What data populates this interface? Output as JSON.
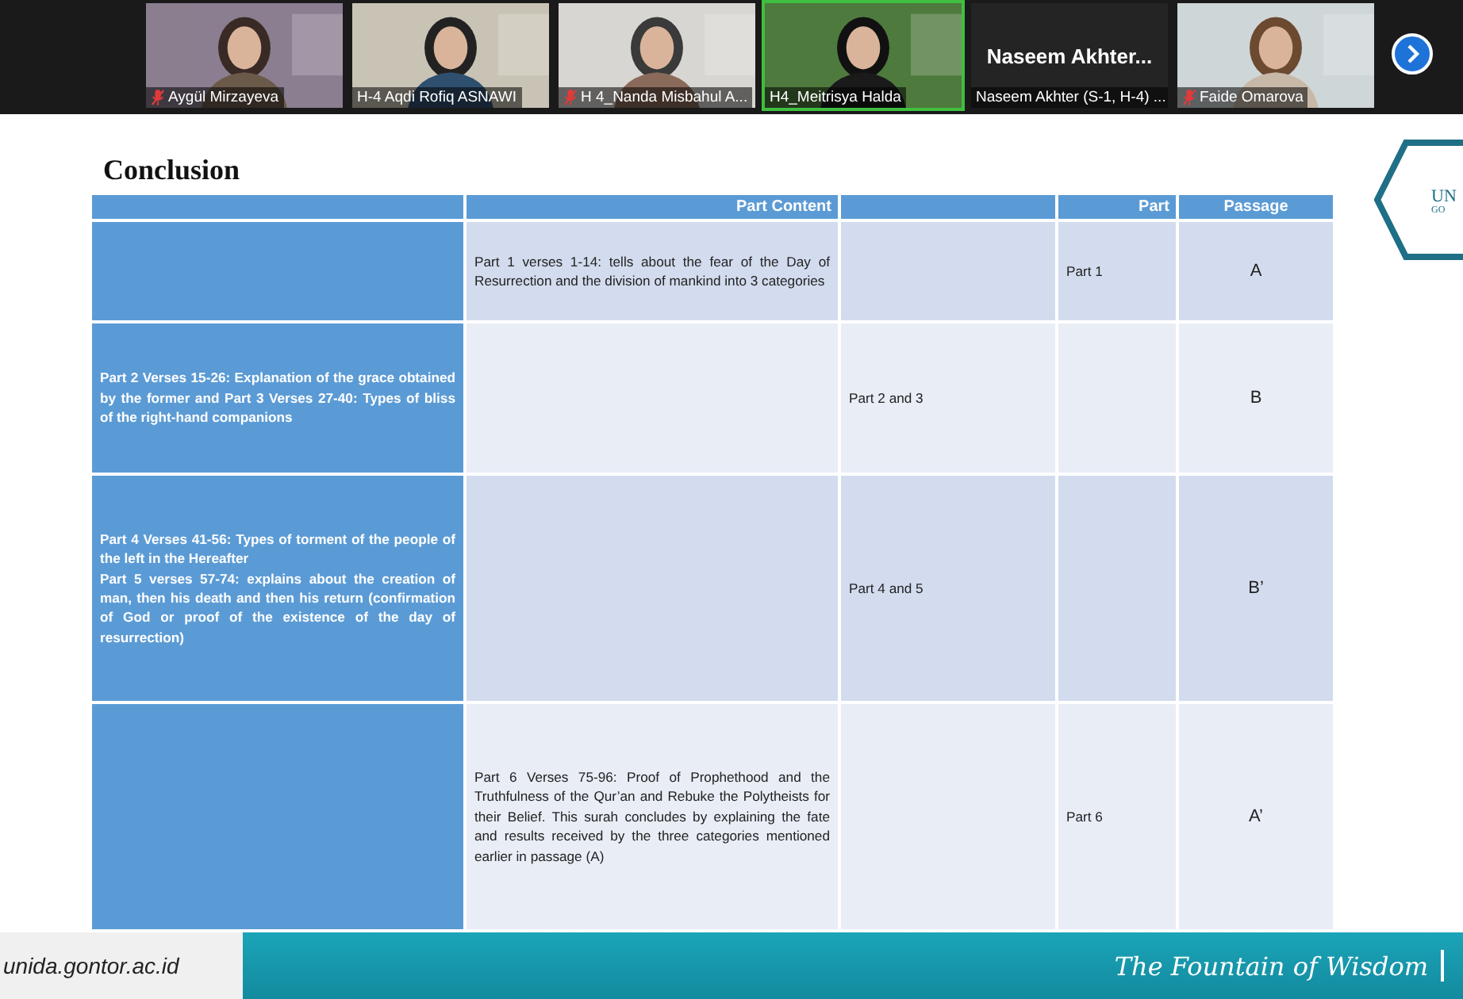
{
  "participants": [
    {
      "kind": "video",
      "name": "Aygül Mirzayeva",
      "muted": true,
      "speaking": false
    },
    {
      "kind": "video",
      "name": "H-4 Aqdi Rofiq ASNAWI",
      "muted": false,
      "speaking": false
    },
    {
      "kind": "video",
      "name": "H 4_Nanda Misbahul A...",
      "muted": true,
      "speaking": false
    },
    {
      "kind": "video",
      "name": "H4_Meitrisya Halda",
      "muted": false,
      "speaking": true
    },
    {
      "kind": "name",
      "display_name": "Naseem  Akhter...",
      "name": "Naseem Akhter (S-1, H-4) ...",
      "muted": false,
      "speaking": false
    },
    {
      "kind": "video",
      "name": "Faide Omarova",
      "muted": true,
      "speaking": false
    }
  ],
  "slide": {
    "title": "Conclusion",
    "logo": {
      "line_1": "UN",
      "line_2": "GO"
    },
    "table": {
      "columns": [
        "",
        "Part Content",
        "",
        "Part",
        "Passage"
      ],
      "rows": [
        [
          "",
          "Part 1 verses 1-14: tells about the fear of the Day of Resurrection and the division of mankind into 3 categories",
          "",
          "Part 1",
          "A"
        ],
        [
          "Part 2 Verses 15-26: Explanation of the grace obtained by the former and Part 3 Verses 27-40: Types of bliss of the right-hand companions",
          "",
          "Part 2 and 3",
          "",
          "B"
        ],
        [
          "Part 4 Verses 41-56: Types of torment of the people of the left in the Hereafter\nPart 5 verses 57-74: explains about the creation of man, then his death and then his return (confirmation of God or proof of the existence of the day of resurrection)",
          "",
          "Part 4 and 5",
          "",
          "B’"
        ],
        [
          "",
          "Part 6 Verses 75-96: Proof of Prophethood and the Truthfulness of the Qur’an and Rebuke the Polytheists for their Belief. This surah concludes by explaining the fate and results received by the three categories mentioned earlier in passage (A)",
          "",
          "Part 6",
          "A’"
        ]
      ]
    },
    "footer": {
      "website": "unida.gontor.ac.id",
      "motto": "The Fountain of Wisdom"
    }
  }
}
